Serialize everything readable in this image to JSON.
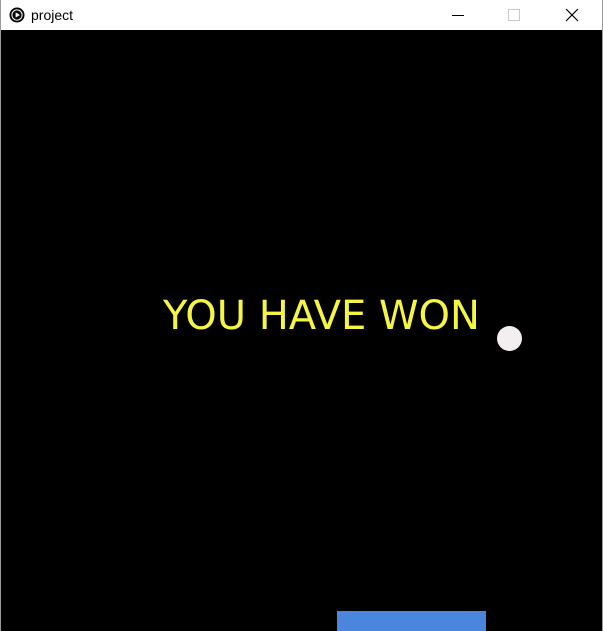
{
  "window": {
    "title": "project",
    "icon": "play-circle-icon",
    "controls": [
      "minimize-icon",
      "maximize-icon",
      "close-icon"
    ]
  },
  "game": {
    "message": "YOU HAVE WON",
    "colors": {
      "background": "#000000",
      "message": "#f5f542",
      "ball": "#f3eef0",
      "paddle": "#4a86de"
    }
  }
}
